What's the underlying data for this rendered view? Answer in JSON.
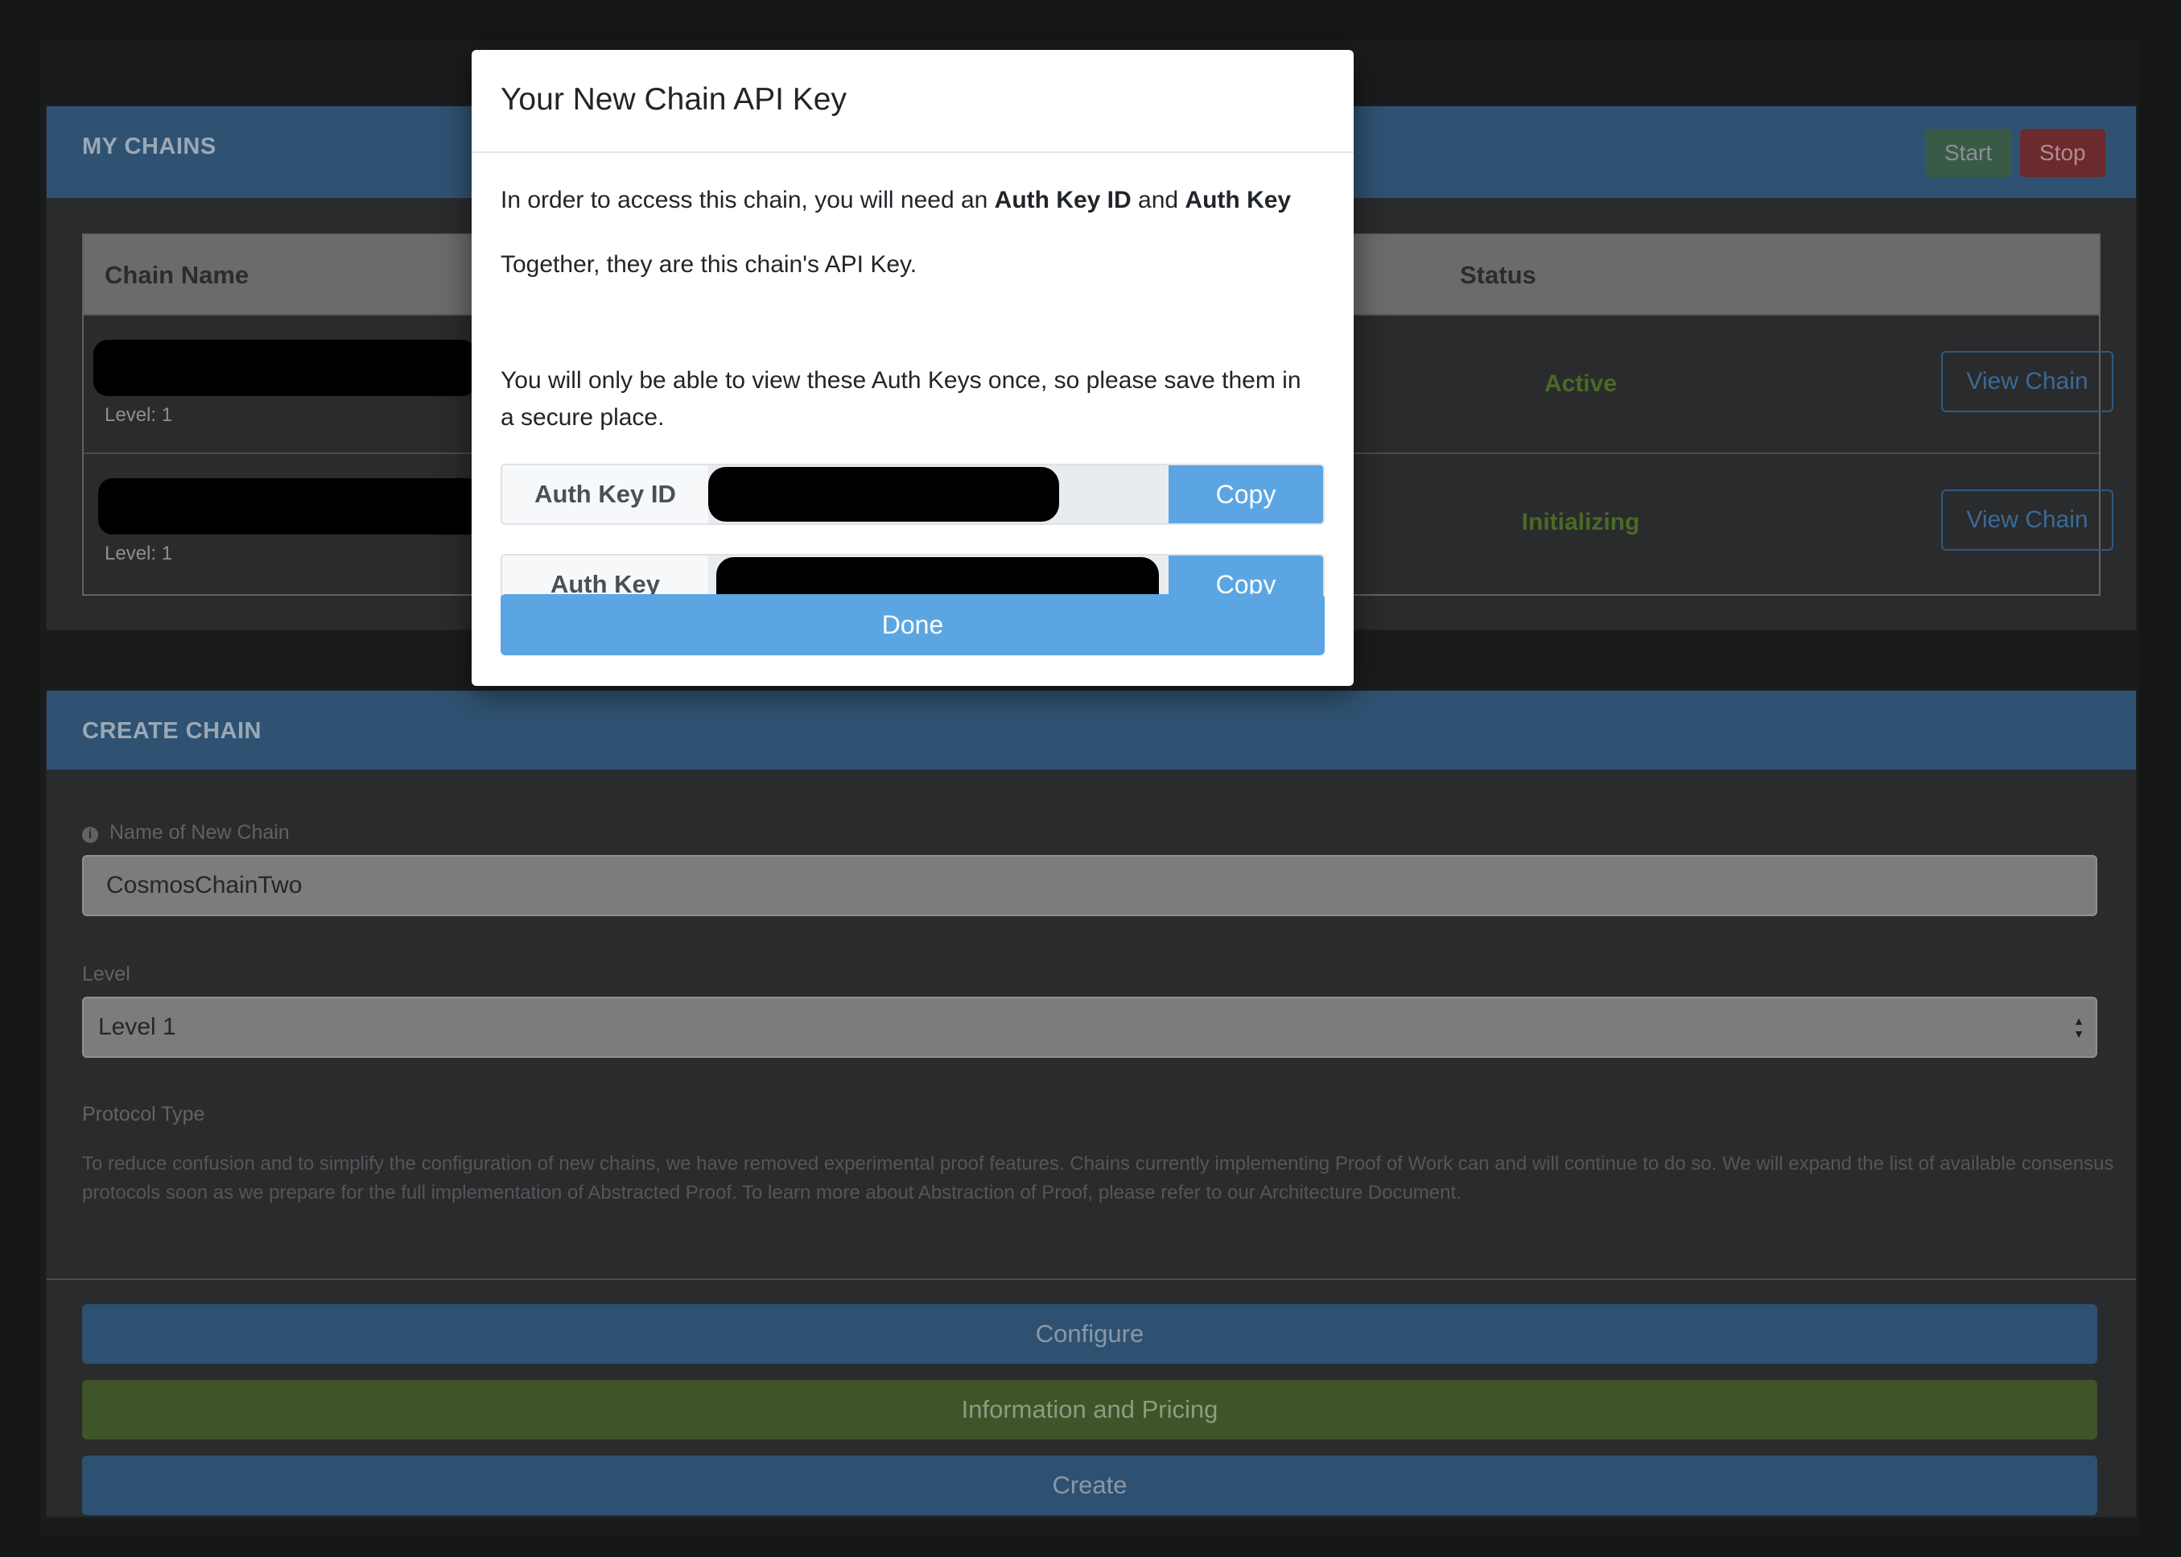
{
  "my_chains": {
    "title": "MY CHAINS",
    "start_label": "Start",
    "stop_label": "Stop",
    "columns": {
      "chain_name": "Chain Name",
      "status": "Status"
    },
    "rows": [
      {
        "level": "Level: 1",
        "status": "Active",
        "action": "View Chain"
      },
      {
        "level": "Level: 1",
        "status": "Initializing",
        "action": "View Chain"
      }
    ]
  },
  "create_chain": {
    "title": "CREATE CHAIN",
    "name_label": "Name of New Chain",
    "name_value": "CosmosChainTwo",
    "level_label": "Level",
    "level_value": "Level 1",
    "protocol_label": "Protocol Type",
    "protocol_text": "To reduce confusion and to simplify the configuration of new chains, we have removed experimental proof features. Chains currently implementing Proof of Work can and will continue to do so. We will expand the list of available consensus protocols soon as we prepare for the full implementation of Abstracted Proof. To learn more about Abstraction of Proof, please refer to our Architecture Document.",
    "configure_label": "Configure",
    "info_label": "Information and Pricing",
    "create_label": "Create"
  },
  "modal": {
    "title": "Your New Chain API Key",
    "p1_prefix": "In order to access this chain, you will need an ",
    "p1_bold1": "Auth Key ID",
    "p1_mid": " and ",
    "p1_bold2": "Auth Key",
    "p2": "Together, they are this chain's API Key.",
    "p3": "You will only be able to view these Auth Keys once, so please save them in a secure place.",
    "auth_key_id_label": "Auth Key ID",
    "auth_key_label": "Auth Key",
    "copy_label": "Copy",
    "done_label": "Done"
  },
  "colors": {
    "accent": "#5ba6e2",
    "status_active": "#4a6a27",
    "panel_header": "#2f5272"
  }
}
